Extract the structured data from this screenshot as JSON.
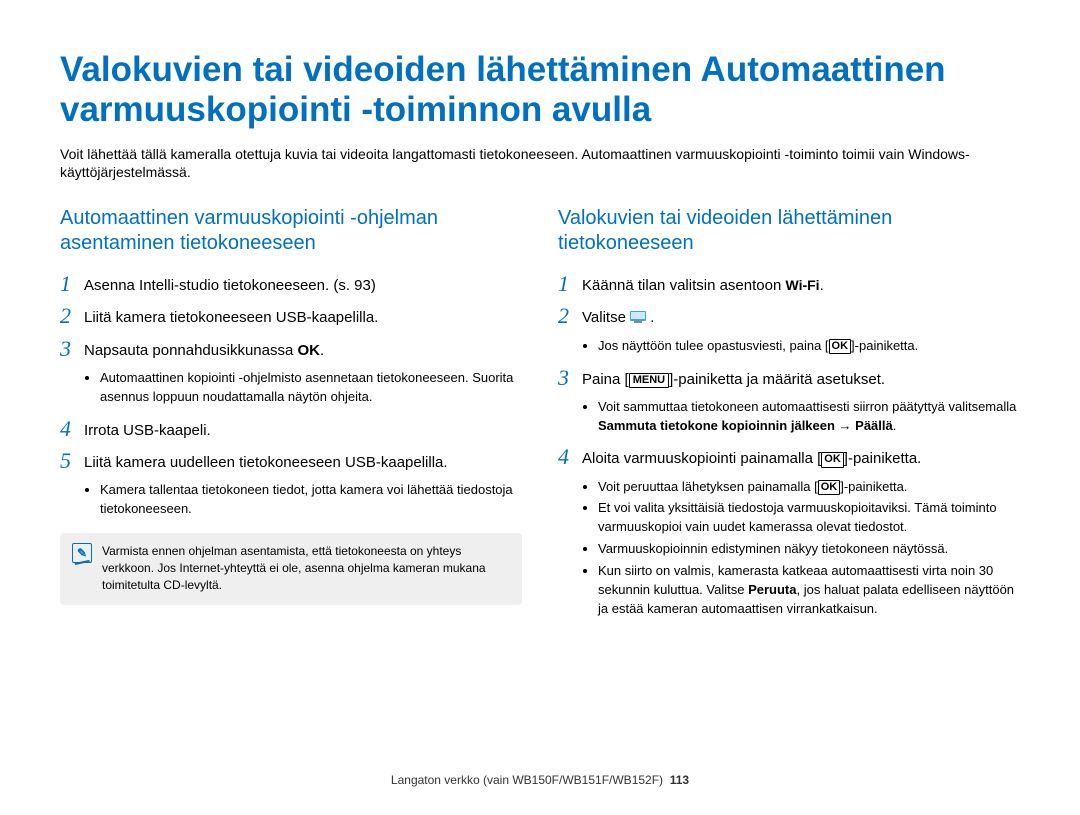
{
  "title": "Valokuvien tai videoiden lähettäminen Automaattinen varmuuskopiointi -toiminnon avulla",
  "intro": "Voit lähettää tällä kameralla otettuja kuvia tai videoita langattomasti tietokoneeseen. Automaattinen varmuuskopiointi -toiminto toimii vain Windows-käyttöjärjestelmässä.",
  "left": {
    "heading": "Automaattinen varmuuskopiointi -ohjelman asentaminen tietokoneeseen",
    "steps": {
      "s1": "Asenna Intelli-studio tietokoneeseen. (s. 93)",
      "s2": "Liitä kamera tietokoneeseen USB-kaapelilla.",
      "s3_pre": "Napsauta ponnahdusikkunassa ",
      "s3_bold": "OK",
      "s3_post": ".",
      "s3_bul": "Automaattinen kopiointi -ohjelmisto asennetaan tietokoneeseen. Suorita asennus loppuun noudattamalla näytön ohjeita.",
      "s4": "Irrota USB-kaapeli.",
      "s5": "Liitä kamera uudelleen tietokoneeseen USB-kaapelilla.",
      "s5_bul": "Kamera tallentaa tietokoneen tiedot, jotta kamera voi lähettää tiedostoja tietokoneeseen."
    },
    "note": "Varmista ennen ohjelman asentamista, että tietokoneesta on yhteys verkkoon. Jos Internet-yhteyttä ei ole, asenna ohjelma kameran mukana toimitetulta CD-levyltä."
  },
  "right": {
    "heading": "Valokuvien tai videoiden lähettäminen tietokoneeseen",
    "steps": {
      "s1_pre": "Käännä tilan valitsin asentoon ",
      "s1_icon_label": "Wi-Fi",
      "s1_post": ".",
      "s2_pre": "Valitse ",
      "s2_post": ".",
      "s2_bul_pre": "Jos näyttöön tulee opastusviesti, paina [",
      "s2_bul_icon": "OK",
      "s2_bul_post": "]-painiketta.",
      "s3_pre": "Paina [",
      "s3_icon": "MENU",
      "s3_mid": "]-painiketta ja määritä asetukset.",
      "s3_bul_pre": "Voit sammuttaa tietokoneen automaattisesti siirron päätyttyä valitsemalla ",
      "s3_bul_bold": "Sammuta tietokone kopioinnin jälkeen → Päällä",
      "s3_bul_post": ".",
      "s4_pre": "Aloita varmuuskopiointi painamalla [",
      "s4_icon": "OK",
      "s4_post": "]-painiketta.",
      "s4_b1_pre": "Voit peruuttaa lähetyksen painamalla [",
      "s4_b1_icon": "OK",
      "s4_b1_post": "]-painiketta.",
      "s4_b2": "Et voi valita yksittäisiä tiedostoja varmuuskopioitaviksi. Tämä toiminto varmuuskopioi vain uudet kamerassa olevat tiedostot.",
      "s4_b3": "Varmuuskopioinnin edistyminen näkyy tietokoneen näytössä.",
      "s4_b4_pre": "Kun siirto on valmis, kamerasta katkeaa automaattisesti virta noin 30 sekunnin kuluttua. Valitse ",
      "s4_b4_bold": "Peruuta",
      "s4_b4_post": ", jos haluat palata edelliseen näyttöön ja estää kameran automaattisen virrankatkaisun."
    }
  },
  "footer": {
    "text": "Langaton verkko (vain WB150F/WB151F/WB152F)",
    "page": "113"
  }
}
